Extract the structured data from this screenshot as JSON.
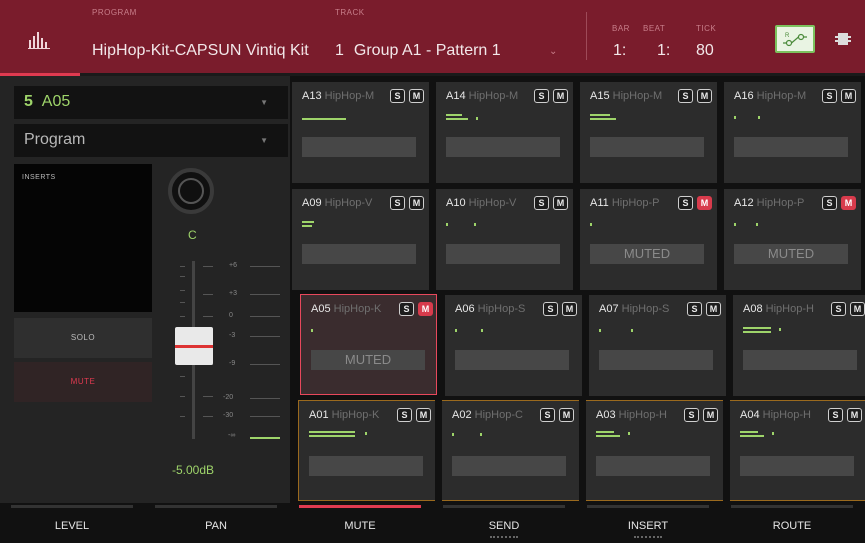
{
  "header": {
    "program_label": "PROGRAM",
    "program_name": "HipHop-Kit-CAPSUN Vintiq Kit",
    "track_label": "TRACK",
    "track_number": "1",
    "track_name": "Group A1 - Pattern 1",
    "bar_label": "BAR",
    "beat_label": "BEAT",
    "tick_label": "TICK",
    "bar_value": "1:",
    "beat_value": "1:",
    "tick_value": "80"
  },
  "left": {
    "pad_number": "5",
    "pad_name": "A05",
    "mode": "Program",
    "inserts_label": "INSERTS",
    "solo_label": "SOLO",
    "mute_label": "MUTE",
    "pan_value": "C",
    "level_db": "-5.00dB",
    "scale": [
      "+6",
      "+3",
      "0",
      "-3",
      "-9",
      "-20",
      "-30",
      "-∞"
    ]
  },
  "pads": [
    {
      "id": "A13",
      "name": "HipHop-M",
      "s": "S",
      "m": "M",
      "muted": false,
      "muted_text": ""
    },
    {
      "id": "A14",
      "name": "HipHop-M",
      "s": "S",
      "m": "M",
      "muted": false,
      "muted_text": ""
    },
    {
      "id": "A15",
      "name": "HipHop-M",
      "s": "S",
      "m": "M",
      "muted": false,
      "muted_text": ""
    },
    {
      "id": "A16",
      "name": "HipHop-M",
      "s": "S",
      "m": "M",
      "muted": false,
      "muted_text": ""
    },
    {
      "id": "A09",
      "name": "HipHop-V",
      "s": "S",
      "m": "M",
      "muted": false,
      "muted_text": ""
    },
    {
      "id": "A10",
      "name": "HipHop-V",
      "s": "S",
      "m": "M",
      "muted": false,
      "muted_text": ""
    },
    {
      "id": "A11",
      "name": "HipHop-P",
      "s": "S",
      "m": "M",
      "muted": true,
      "muted_text": "MUTED"
    },
    {
      "id": "A12",
      "name": "HipHop-P",
      "s": "S",
      "m": "M",
      "muted": true,
      "muted_text": "MUTED"
    },
    {
      "id": "A05",
      "name": "HipHop-K",
      "s": "S",
      "m": "M",
      "muted": true,
      "muted_text": "MUTED"
    },
    {
      "id": "A06",
      "name": "HipHop-S",
      "s": "S",
      "m": "M",
      "muted": false,
      "muted_text": ""
    },
    {
      "id": "A07",
      "name": "HipHop-S",
      "s": "S",
      "m": "M",
      "muted": false,
      "muted_text": ""
    },
    {
      "id": "A08",
      "name": "HipHop-H",
      "s": "S",
      "m": "M",
      "muted": false,
      "muted_text": ""
    },
    {
      "id": "A01",
      "name": "HipHop-K",
      "s": "S",
      "m": "M",
      "muted": false,
      "muted_text": ""
    },
    {
      "id": "A02",
      "name": "HipHop-C",
      "s": "S",
      "m": "M",
      "muted": false,
      "muted_text": ""
    },
    {
      "id": "A03",
      "name": "HipHop-H",
      "s": "S",
      "m": "M",
      "muted": false,
      "muted_text": ""
    },
    {
      "id": "A04",
      "name": "HipHop-H",
      "s": "S",
      "m": "M",
      "muted": false,
      "muted_text": ""
    }
  ],
  "tabs": [
    "LEVEL",
    "PAN",
    "MUTE",
    "SEND",
    "INSERT",
    "ROUTE"
  ],
  "active_tab": "MUTE",
  "colors": {
    "header": "#7a1c2c",
    "accent_green": "#9ed46a",
    "mute_red": "#d83b4c",
    "selected_pad": "#e8485c",
    "group_outline": "#9b6a1e"
  }
}
